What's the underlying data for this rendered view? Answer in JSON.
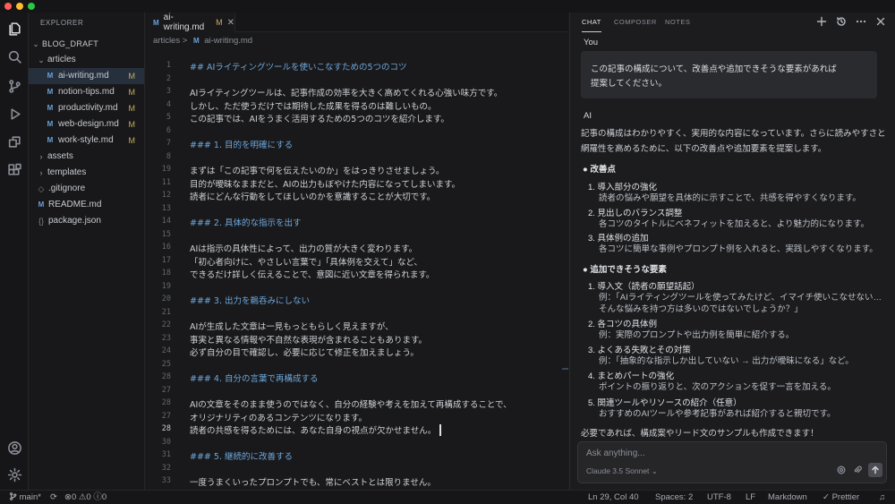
{
  "window": {
    "traffic_lights": [
      "#ff5f57",
      "#febc2e",
      "#28c840"
    ]
  },
  "activity_bar": {
    "top": [
      "files-icon",
      "search-icon",
      "source-control-icon",
      "run-debug-icon",
      "remote-explorer-icon",
      "extensions-icon"
    ],
    "bottom": [
      "account-icon",
      "settings-icon"
    ]
  },
  "explorer": {
    "header": "EXPLORER",
    "root": "BLOG_DRAFT",
    "folder_articles": "articles",
    "files": [
      {
        "name": "ai-writing.md",
        "badge": "M",
        "selected": true
      },
      {
        "name": "notion-tips.md",
        "badge": "M"
      },
      {
        "name": "productivity.md",
        "badge": "M"
      },
      {
        "name": "web-design.md",
        "badge": "M"
      },
      {
        "name": "work-style.md",
        "badge": "M"
      }
    ],
    "folders": [
      "assets",
      "templates"
    ],
    "root_files": [
      ".gitignore",
      "README.md",
      "package.json"
    ],
    "md_icon": "M"
  },
  "editor": {
    "tab": {
      "name": "ai-writing.md",
      "modified": "M",
      "close": "✕"
    },
    "breadcrumb": {
      "folder": "articles",
      "sep": ">",
      "file": "ai-writing.md"
    },
    "lines": [
      {
        "n": "1",
        "t": "## AIライティングツールを使いこなすための5つのコツ",
        "h": true
      },
      {
        "n": "2",
        "t": ""
      },
      {
        "n": "3",
        "t": "AIライティングツールは、記事作成の効率を大きく高めてくれる心強い味方です。"
      },
      {
        "n": "4",
        "t": "しかし、ただ使うだけでは期待した成果を得るのは難しいもの。"
      },
      {
        "n": "5",
        "t": "この記事では、AIをうまく活用するための5つのコツを紹介します。"
      },
      {
        "n": "6",
        "t": ""
      },
      {
        "n": "7",
        "t": "### 1. 目的を明確にする",
        "h": true
      },
      {
        "n": "8",
        "t": ""
      },
      {
        "n": "19",
        "t": "まずは「この記事で何を伝えたいのか」をはっきりさせましょう。"
      },
      {
        "n": "11",
        "t": "目的が曖昧なままだと、AIの出力もぼやけた内容になってしまいます。"
      },
      {
        "n": "12",
        "t": "読者にどんな行動をしてほしいのかを意識することが大切です。"
      },
      {
        "n": "13",
        "t": ""
      },
      {
        "n": "14",
        "t": "### 2. 具体的な指示を出す",
        "h": true
      },
      {
        "n": "15",
        "t": ""
      },
      {
        "n": "16",
        "t": "AIは指示の具体性によって、出力の質が大きく変わります。"
      },
      {
        "n": "17",
        "t": "「初心者向けに、やさしい言葉で」「具体例を交えて」など、"
      },
      {
        "n": "18",
        "t": "できるだけ詳しく伝えることで、意図に近い文章を得られます。"
      },
      {
        "n": "19",
        "t": ""
      },
      {
        "n": "20",
        "t": "### 3. 出力を鵜呑みにしない",
        "h": true
      },
      {
        "n": "21",
        "t": ""
      },
      {
        "n": "22",
        "t": "AIが生成した文章は一見もっともらしく見えますが、"
      },
      {
        "n": "23",
        "t": "事実と異なる情報や不自然な表現が含まれることもあります。"
      },
      {
        "n": "24",
        "t": "必ず自分の目で確認し、必要に応じて修正を加えましょう。"
      },
      {
        "n": "25",
        "t": ""
      },
      {
        "n": "28",
        "t": "### 4. 自分の言葉で再構成する",
        "h": true
      },
      {
        "n": "27",
        "t": ""
      },
      {
        "n": "28",
        "t": "AIの文章をそのまま使うのではなく、自分の経験や考えを加えて再構成することで、"
      },
      {
        "n": "27",
        "t": "オリジナリティのあるコンテンツになります。"
      },
      {
        "n": "28",
        "t": "読者の共感を得るためには、あなた自身の視点が欠かせません。",
        "cur": true
      },
      {
        "n": "30",
        "t": ""
      },
      {
        "n": "31",
        "t": "### 5. 継続的に改善する",
        "h": true
      },
      {
        "n": "32",
        "t": ""
      },
      {
        "n": "33",
        "t": "一度うまくいったプロンプトでも、常にベストとは限りません。"
      },
      {
        "n": "34",
        "t": "定期的に振り返り、より良い指示の出し方を模索し続けましょう。"
      }
    ]
  },
  "chat": {
    "tabs": [
      "CHAT",
      "COMPOSER",
      "NOTES"
    ],
    "header_icons": [
      "new-chat-icon",
      "history-icon",
      "more-icon",
      "close-icon"
    ],
    "you_label": "You",
    "user_message": [
      "この記事の構成について、改善点や追加できそうな要素があれば",
      "提案してください。"
    ],
    "ai_label": "AI",
    "intro": [
      "記事の構成はわかりやすく、実用的な内容になっています。さらに読みやすさと",
      "網羅性を高めるために、以下の改善点や追加要素を提案します。"
    ],
    "section1": "● 改善点",
    "improvements": [
      {
        "title": "1.  導入部分の強化",
        "desc": "読者の悩みや願望を具体的に示すことで、共感を得やすくなります。"
      },
      {
        "title": "2.  見出しのバランス調整",
        "desc": "各コツのタイトルにベネフィットを加えると、より魅力的になります。"
      },
      {
        "title": "3.  具体例の追加",
        "desc": "各コツに簡単な事例やプロンプト例を入れると、実践しやすくなります。"
      }
    ],
    "section2": "● 追加できそうな要素",
    "additions": [
      {
        "title": "1.  導入文（読者の願望話起）",
        "desc": [
          "例：「AIライティングツールを使ってみたけど、イマイチ使いこなせない…",
          "そんな悩みを持つ方は多いのではないでしょうか？」"
        ]
      },
      {
        "title": "2.  各コツの具体例",
        "desc": [
          "例：実際のプロンプトや出力例を簡単に紹介する。"
        ]
      },
      {
        "title": "3.  よくある失敗とその対策",
        "desc": [
          "例：「抽象的な指示しか出していない → 出力が曖昧になる」など。"
        ]
      },
      {
        "title": "4.  まとめパートの強化",
        "desc": [
          "ポイントの振り返りと、次のアクションを促す一言を加える。"
        ]
      },
      {
        "title": "5.  関連ツールやリソースの紹介（任意）",
        "desc": [
          "おすすめのAIツールや参考記事があれば紹介すると親切です。"
        ]
      }
    ],
    "closing": "必要であれば、構成案やリード文のサンプルも作成できます！",
    "input": {
      "placeholder": "Ask anything...",
      "model": "Claude 3.5 Sonnet ⌄"
    }
  },
  "status": {
    "branch": "main*",
    "problems": "⊗0  ⚠0  ⓘ0",
    "position": "Ln 29, Col 40",
    "spaces": "Spaces: 2",
    "encoding": "UTF-8",
    "eol": "LF",
    "language": "Markdown",
    "formatter": "✓ Prettier"
  }
}
